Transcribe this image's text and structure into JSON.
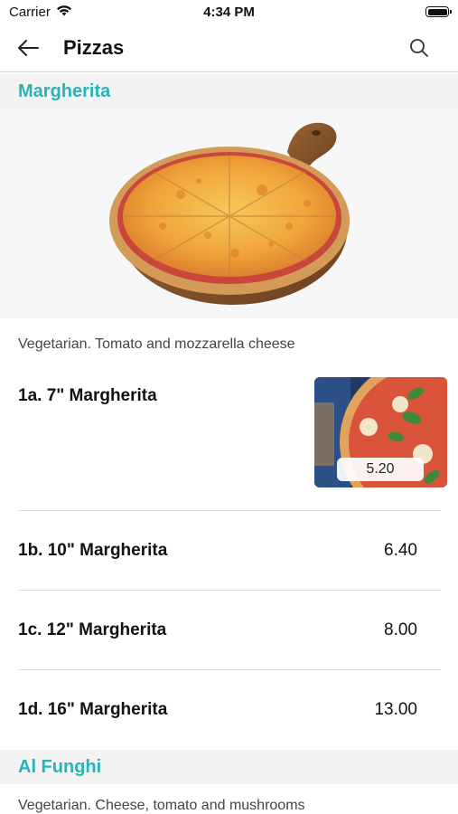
{
  "status_bar": {
    "carrier": "Carrier",
    "time": "4:34 PM"
  },
  "nav": {
    "title": "Pizzas",
    "back_icon": "arrow-left-icon",
    "search_icon": "search-icon"
  },
  "sections": [
    {
      "title": "Margherita",
      "description": "Vegetarian. Tomato and mozzarella cheese",
      "items": [
        {
          "name": "1a. 7\" Margherita",
          "price": "5.20"
        },
        {
          "name": "1b. 10\" Margherita",
          "price": "6.40"
        },
        {
          "name": "1c. 12\" Margherita",
          "price": "8.00"
        },
        {
          "name": "1d. 16\" Margherita",
          "price": "13.00"
        }
      ]
    },
    {
      "title": "Al Funghi",
      "description": "Vegetarian. Cheese, tomato and mushrooms"
    }
  ],
  "colors": {
    "accent": "#27b3b8",
    "section_bg": "#f3f3f3"
  }
}
